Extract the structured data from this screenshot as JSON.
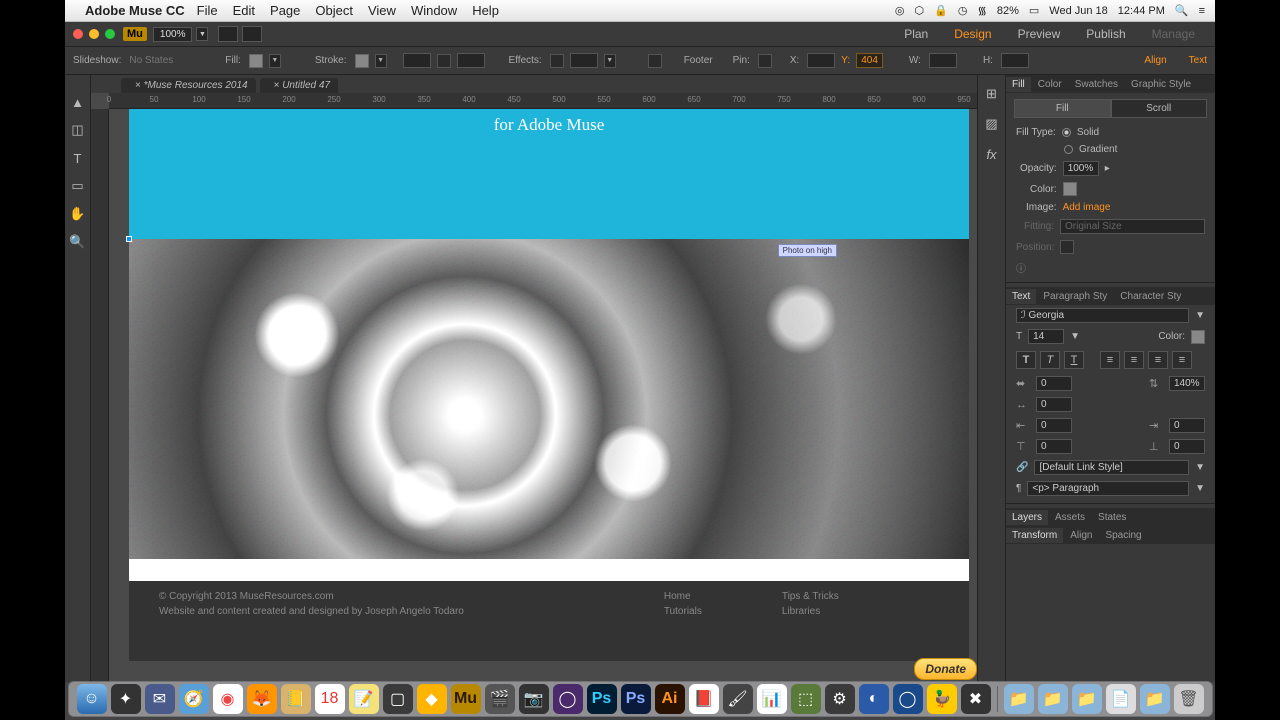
{
  "mac": {
    "app_name": "Adobe Muse CC",
    "menus": [
      "File",
      "Edit",
      "Page",
      "Object",
      "View",
      "Window",
      "Help"
    ],
    "battery": "82%",
    "date": "Wed Jun 18",
    "time": "12:44 PM"
  },
  "modes": {
    "plan": "Plan",
    "design": "Design",
    "preview": "Preview",
    "publish": "Publish",
    "manage": "Manage"
  },
  "zoom": "100%",
  "options": {
    "slideshow": "Slideshow:",
    "states": "No States",
    "fill": "Fill:",
    "stroke": "Stroke:",
    "effects": "Effects:",
    "footer": "Footer",
    "pin": "Pin:",
    "x": "X:",
    "y": "Y:",
    "yval": "404",
    "w": "W:",
    "h": "H:",
    "align": "Align",
    "text": "Text"
  },
  "tabs": {
    "a": "*Muse Resources 2014",
    "b": "Untitled 47"
  },
  "ruler": [
    "0",
    "50",
    "100",
    "150",
    "200",
    "250",
    "300",
    "350",
    "400",
    "450",
    "500",
    "550",
    "600",
    "650",
    "700",
    "750",
    "800",
    "850",
    "900",
    "950"
  ],
  "hero": "for Adobe Muse",
  "footer": {
    "copy": "© Copyright 2013 MuseResources.com",
    "credit": "Website and content created and designed by Joseph Angelo Todaro",
    "col1": [
      "Home",
      "Tutorials"
    ],
    "col2": [
      "Tips & Tricks",
      "Libraries"
    ],
    "donate": "Donate"
  },
  "fill_panel": {
    "tabs": [
      "Fill",
      "Color",
      "Swatches",
      "Graphic Style"
    ],
    "sub": [
      "Fill",
      "Scroll"
    ],
    "filltype": "Fill Type:",
    "solid": "Solid",
    "gradient": "Gradient",
    "opacity": "Opacity:",
    "opacity_val": "100%",
    "color": "Color:",
    "image": "Image:",
    "add": "Add image",
    "fitting": "Fitting:",
    "fitting_val": "Original Size",
    "position": "Position:"
  },
  "text_panel": {
    "tabs": [
      "Text",
      "Paragraph Sty",
      "Character Sty"
    ],
    "font": "Georgia",
    "size": "14",
    "leading": "140%",
    "color": "Color:",
    "zero": "0",
    "link": "[Default Link Style]",
    "tag": "<p> Paragraph"
  },
  "bottom_tabs1": [
    "Layers",
    "Assets",
    "States"
  ],
  "bottom_tabs2": [
    "Transform",
    "Align",
    "Spacing"
  ]
}
